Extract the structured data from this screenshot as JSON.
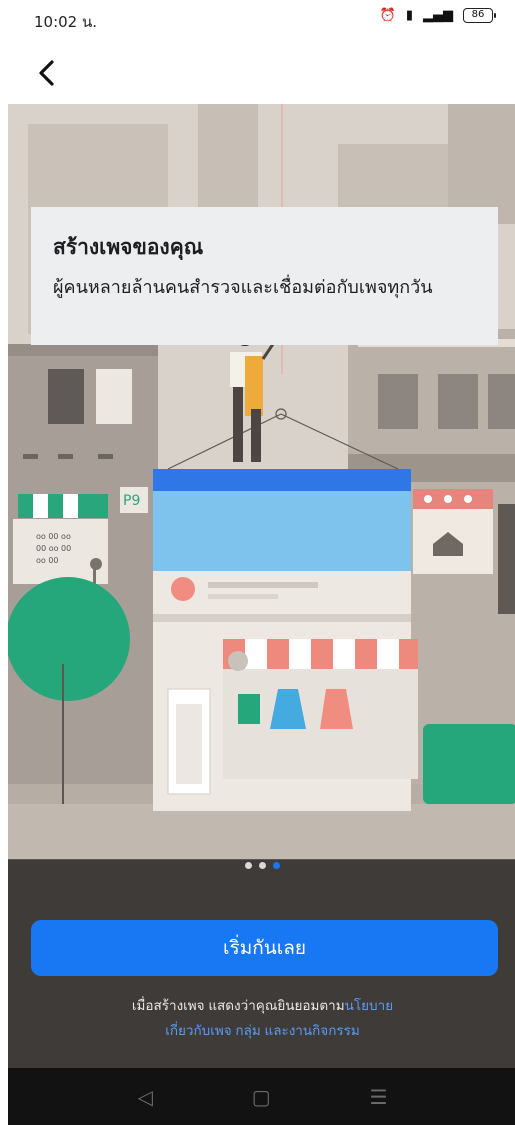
{
  "status": {
    "time": "10:02 น.",
    "battery": "86",
    "network": "4G"
  },
  "card": {
    "title": "สร้างเพจของคุณ",
    "description": "ผู้คนหลายล้านคนสำรวจและเชื่อมต่อกับเพจทุกวัน"
  },
  "illustration": {
    "sign_text": "P9",
    "menu_lines": [
      "oo 00 oo",
      "00 oo 00",
      "oo 00"
    ]
  },
  "pager": {
    "total": 3,
    "active": 3
  },
  "cta": {
    "label": "เริ่มกันเลย"
  },
  "terms": {
    "prefix": "เมื่อสร้างเพจ แสดงว่าคุณยินยอมตาม",
    "link1": "นโยบาย",
    "link2": "เกี่ยวกับเพจ กลุ่ม และงานกิจกรรม"
  },
  "nav": {
    "back": "◁",
    "home": "▢",
    "menu": "☰"
  },
  "colors": {
    "brand": "#1877f2",
    "background": "#d9d3cb",
    "panel": "#3e3b39",
    "card": "#eceeef"
  }
}
